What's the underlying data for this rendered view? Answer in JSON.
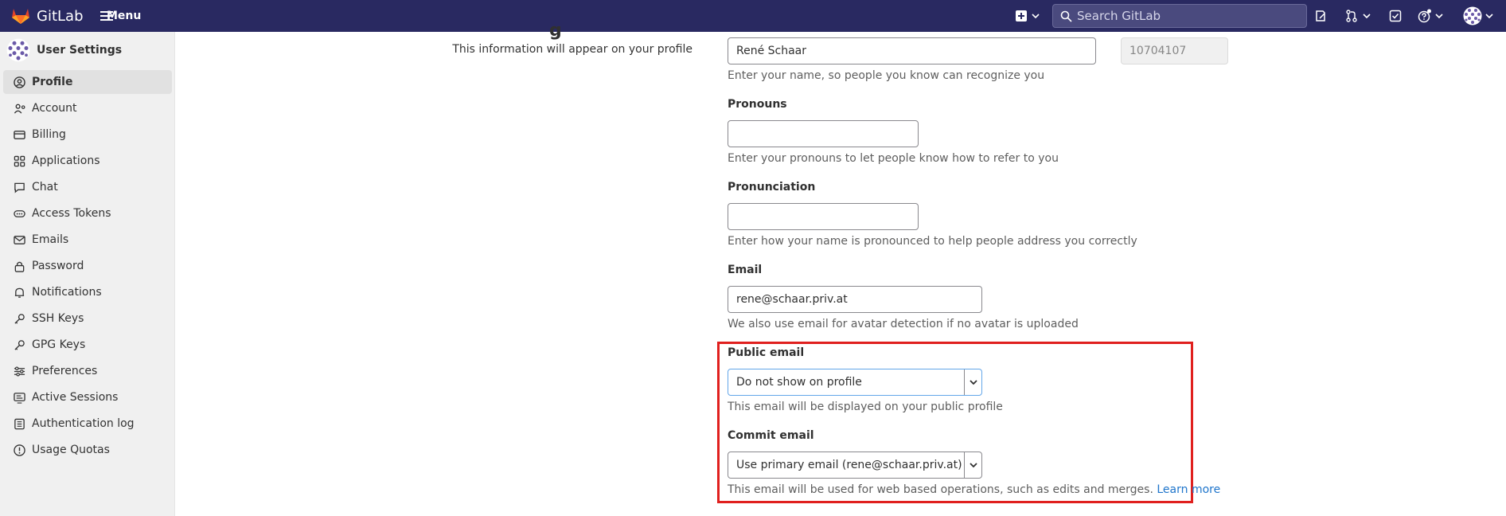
{
  "topbar": {
    "brand": "GitLab",
    "menu_label": "Menu",
    "search_placeholder": "Search GitLab",
    "icons": [
      "plus-square-icon",
      "chevron-down-icon",
      "search-icon",
      "issues-icon",
      "merge-request-icon",
      "todo-icon",
      "help-icon",
      "avatar"
    ]
  },
  "sidebar": {
    "title": "User Settings",
    "items": [
      {
        "label": "Profile",
        "icon": "profile-icon",
        "active": true
      },
      {
        "label": "Account",
        "icon": "account-icon"
      },
      {
        "label": "Billing",
        "icon": "billing-icon"
      },
      {
        "label": "Applications",
        "icon": "applications-icon"
      },
      {
        "label": "Chat",
        "icon": "chat-icon"
      },
      {
        "label": "Access Tokens",
        "icon": "token-icon"
      },
      {
        "label": "Emails",
        "icon": "mail-icon"
      },
      {
        "label": "Password",
        "icon": "lock-icon"
      },
      {
        "label": "Notifications",
        "icon": "bell-icon"
      },
      {
        "label": "SSH Keys",
        "icon": "key-icon"
      },
      {
        "label": "GPG Keys",
        "icon": "key-icon"
      },
      {
        "label": "Preferences",
        "icon": "preferences-icon"
      },
      {
        "label": "Active Sessions",
        "icon": "monitor-icon"
      },
      {
        "label": "Authentication log",
        "icon": "log-icon"
      },
      {
        "label": "Usage Quotas",
        "icon": "quota-icon"
      }
    ]
  },
  "main": {
    "info_text": "This information will appear on your profile",
    "name": {
      "value": "René Schaar",
      "user_id": "10704107",
      "help": "Enter your name, so people you know can recognize you"
    },
    "pronouns": {
      "label": "Pronouns",
      "value": "",
      "help": "Enter your pronouns to let people know how to refer to you"
    },
    "pronunciation": {
      "label": "Pronunciation",
      "value": "",
      "help": "Enter how your name is pronounced to help people address you correctly"
    },
    "email": {
      "label": "Email",
      "value": "rene@schaar.priv.at",
      "help": "We also use email for avatar detection if no avatar is uploaded"
    },
    "public_email": {
      "label": "Public email",
      "value": "Do not show on profile",
      "help": "This email will be displayed on your public profile"
    },
    "commit_email": {
      "label": "Commit email",
      "value": "Use primary email (rene@schaar.priv.at)",
      "help": "This email will be used for web based operations, such as edits and merges.",
      "link": "Learn more"
    }
  },
  "colors": {
    "topbar": "#292961",
    "highlight": "#e0201e",
    "link": "#1f75cb"
  }
}
